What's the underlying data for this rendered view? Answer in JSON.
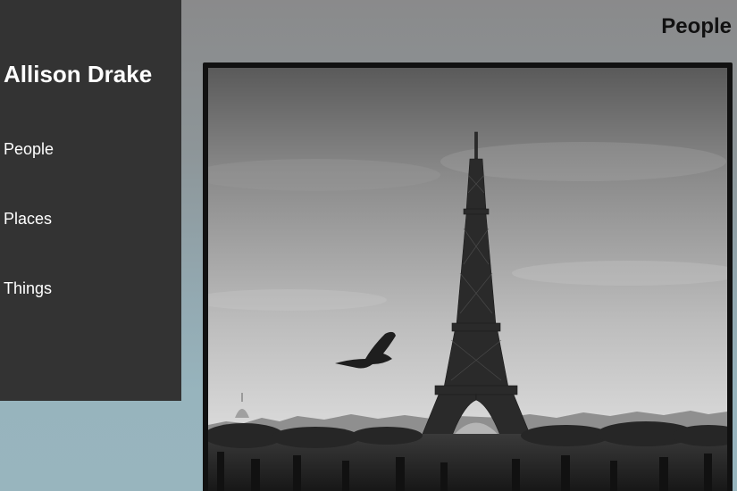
{
  "site": {
    "title": "Allison Drake"
  },
  "nav": {
    "items": [
      {
        "label": "People"
      },
      {
        "label": "Places"
      },
      {
        "label": "Things"
      }
    ]
  },
  "page": {
    "heading": "People"
  },
  "colors": {
    "sidebar_bg": "#333333",
    "sidebar_text": "#ffffff",
    "heading_text": "#111111",
    "frame": "#111111"
  },
  "photo": {
    "subject": "eiffel-tower-with-bird-bw"
  }
}
